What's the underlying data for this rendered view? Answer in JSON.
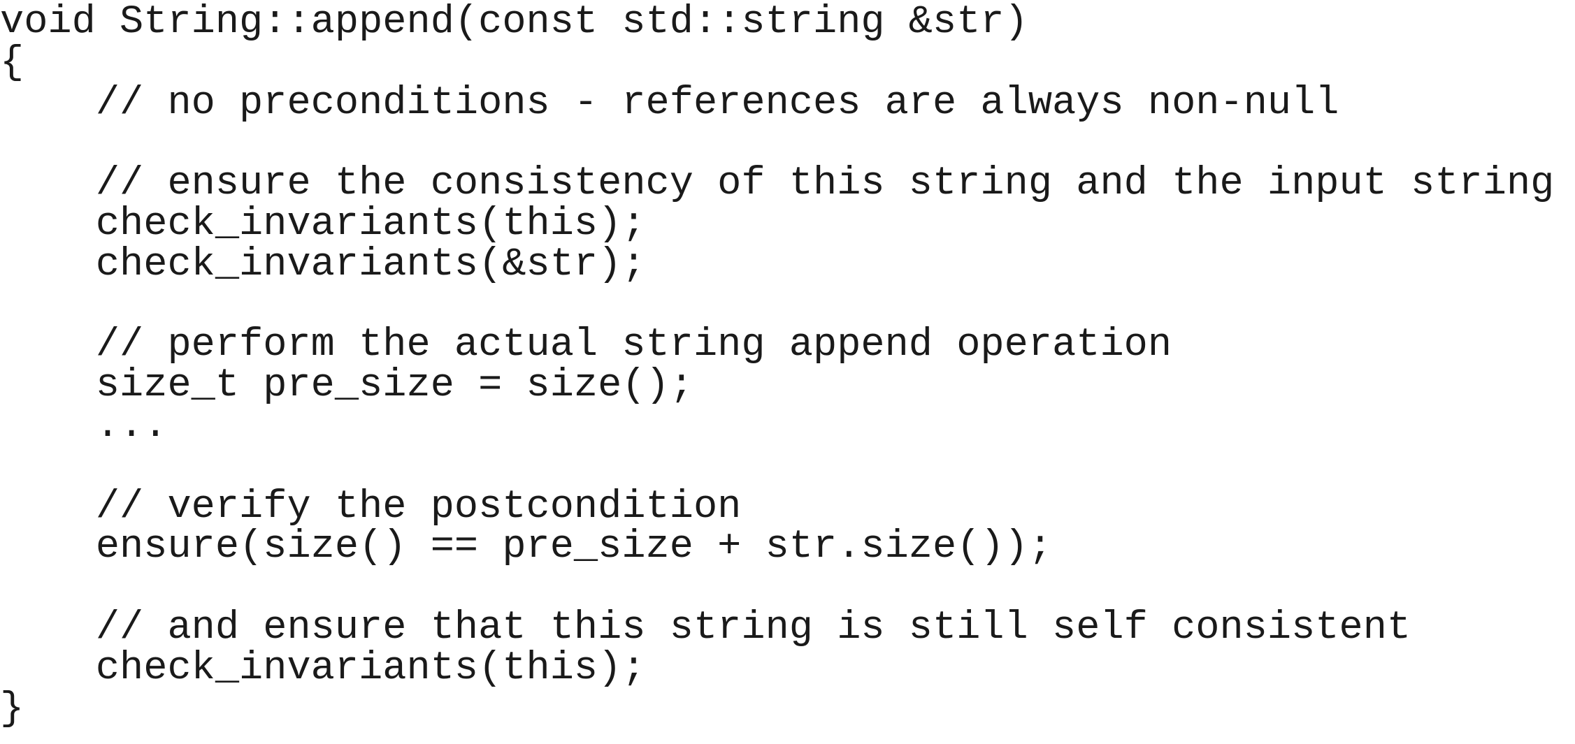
{
  "code": {
    "lines": [
      "void String::append(const std::string &str)",
      "{",
      "    // no preconditions - references are always non-null",
      "",
      "    // ensure the consistency of this string and the input string",
      "    check_invariants(this);",
      "    check_invariants(&str);",
      "",
      "    // perform the actual string append operation",
      "    size_t pre_size = size();",
      "    ...",
      "",
      "    // verify the postcondition",
      "    ensure(size() == pre_size + str.size());",
      "",
      "    // and ensure that this string is still self consistent",
      "    check_invariants(this);",
      "}"
    ]
  }
}
